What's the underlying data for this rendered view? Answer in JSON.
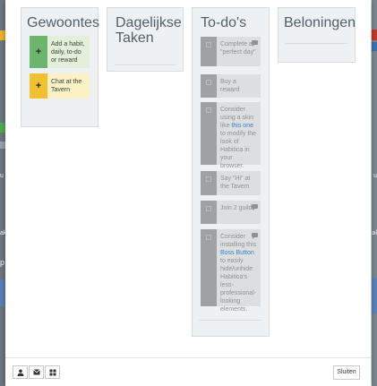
{
  "columns": {
    "habits": {
      "title": "Gewoontes"
    },
    "dailies": {
      "title": "Dagelijkse Taken"
    },
    "todos": {
      "title": "To-do's"
    },
    "rewards": {
      "title": "Beloningen"
    }
  },
  "habits": [
    {
      "plus": "+",
      "text": "Add a habit, daily, to-do or reward",
      "color": "#6cb56c"
    },
    {
      "plus": "+",
      "text": "Chat at the Tavern",
      "color": "#f2c131"
    }
  ],
  "todos": [
    {
      "text": "Complete a \"perfect day\"",
      "has_comment": true
    },
    {
      "text": "Buy a reward",
      "has_comment": false
    },
    {
      "pre": "Consider using a skin like ",
      "link": "this one",
      "post": " to modify the look of Habitica in your browser.",
      "has_comment": false
    },
    {
      "text": "Say \"Hi\" at the Tavern",
      "has_comment": false
    },
    {
      "text": "Join 2 guilds",
      "has_comment": true
    },
    {
      "pre": "Consider installing this ",
      "link": "Boss Button",
      "post": " to easily hide/unhide Habitica's less-professional-looking elements.",
      "has_comment": true
    }
  ],
  "footer": {
    "icons": [
      "user-icon",
      "mail-icon",
      "grid-icon"
    ],
    "close_label": "Sluiten"
  },
  "background": {
    "left_glyphs": [
      "u",
      "ak",
      "p"
    ],
    "right_glyphs": [
      "u",
      "al",
      "lo",
      "ik",
      "or"
    ]
  }
}
